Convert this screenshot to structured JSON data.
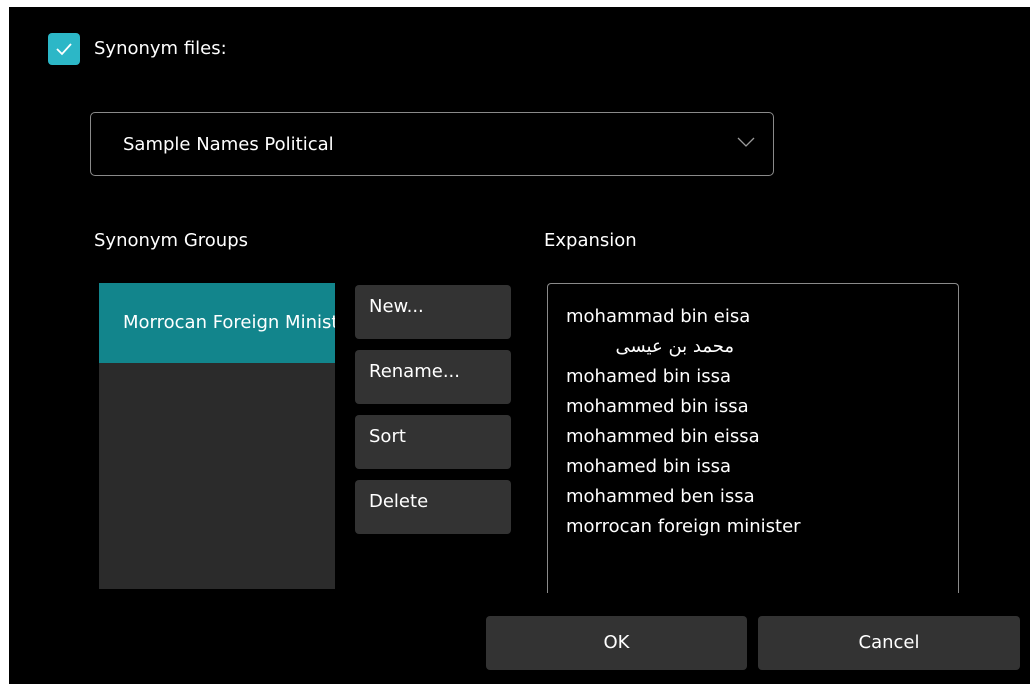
{
  "synonym_files": {
    "label": "Synonym files:",
    "checked": true,
    "icon": "checkmark-icon",
    "accent_color": "#2cb7c7"
  },
  "file_select": {
    "selected": "Sample Names Political",
    "icon": "chevron-down-icon"
  },
  "groups": {
    "label": "Synonym Groups",
    "items": [
      "Morrocan Foreign Minister"
    ],
    "selected_color": "#12858c"
  },
  "actions": {
    "new_label": "New...",
    "rename_label": "Rename...",
    "sort_label": "Sort",
    "delete_label": "Delete"
  },
  "expansion": {
    "label": "Expansion",
    "lines": [
      "mohammad bin eisa",
      "محمد بن عيسى",
      "mohamed bin issa",
      "mohammed bin issa",
      "mohammed bin eissa",
      "mohamed bin issa",
      "mohammed ben issa",
      "morrocan foreign minister"
    ]
  },
  "footer": {
    "ok_label": "OK",
    "cancel_label": "Cancel"
  }
}
